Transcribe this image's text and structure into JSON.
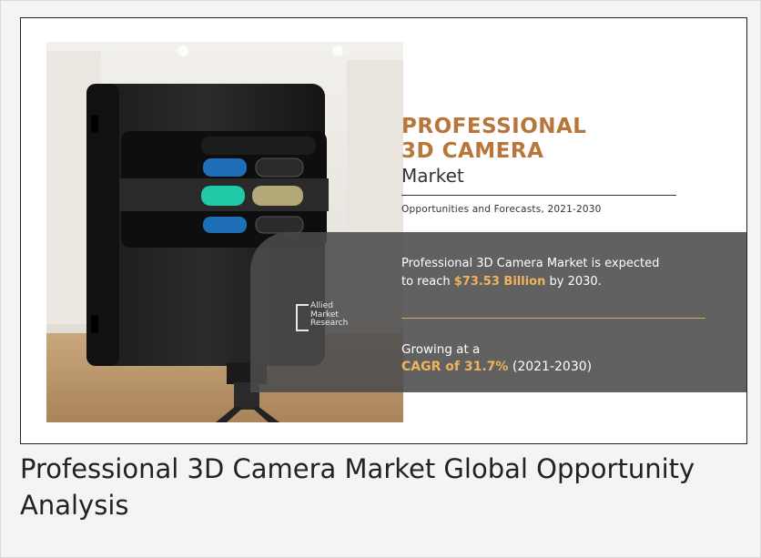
{
  "infographic": {
    "title_line1": "PROFESSIONAL",
    "title_line2": "3D CAMERA",
    "title_line3": "Market",
    "subtitle": "Opportunities and Forecasts, 2021-2030",
    "market_text_line1": "Professional 3D Camera Market is expected",
    "market_text_prefix": "to reach ",
    "market_value": "$73.53 Billion",
    "market_text_suffix": " by 2030.",
    "growth_line1": "Growing at a",
    "cagr": "CAGR of 31.7%",
    "cagr_period": " (2021-2030)",
    "logo_lines": [
      "Allied",
      "Market",
      "Research"
    ]
  },
  "caption": "Professional 3D Camera Market Global Opportunity Analysis",
  "colors": {
    "accent": "#b8763a",
    "highlight": "#f0b35a",
    "band": "#4b4b4b"
  }
}
